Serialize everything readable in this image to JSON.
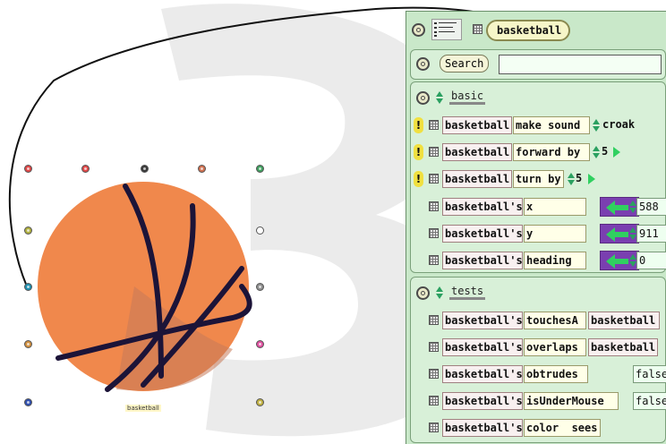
{
  "world": {
    "object_name": "basketball",
    "halo_colors": [
      "#e04848",
      "#e04848",
      "#3a3a3a",
      "#d07050",
      "#40a060",
      "#b0b040",
      "#a0a0a0",
      "#2090b0",
      "#909090",
      "#d09040",
      "#e050a0",
      "#3050b0",
      "#c0b040"
    ]
  },
  "viewer": {
    "name": "basketball",
    "search_label": "Search",
    "search_value": "",
    "categories": [
      {
        "label": "basic",
        "rows": [
          {
            "kind": "command",
            "object": "basketball",
            "message": "make sound",
            "arg": "croak"
          },
          {
            "kind": "command",
            "object": "basketball",
            "message": "forward by",
            "arg": "5"
          },
          {
            "kind": "command",
            "object": "basketball",
            "message": "turn by",
            "arg": "5"
          },
          {
            "kind": "slot",
            "object": "basketball's",
            "slot": "x",
            "value": "588"
          },
          {
            "kind": "slot",
            "object": "basketball's",
            "slot": "y",
            "value": "911"
          },
          {
            "kind": "slot",
            "object": "basketball's",
            "slot": "heading",
            "value": "0"
          }
        ]
      },
      {
        "label": "tests",
        "rows": [
          {
            "object": "basketball's",
            "test": "touchesA",
            "arg": "basketball"
          },
          {
            "object": "basketball's",
            "test": "overlaps",
            "arg": "basketball"
          },
          {
            "object": "basketball's",
            "test": "obtrudes",
            "value": "false"
          },
          {
            "object": "basketball's",
            "test": "isUnderMouse",
            "value": "false"
          },
          {
            "object": "basketball's",
            "test": "color  sees",
            "value": ""
          }
        ]
      }
    ]
  },
  "colors": {
    "ball": "#f0884c",
    "seams": "#1c1438",
    "background_digit": "#ebebeb",
    "viewer_bg": "#c9e8c9"
  }
}
